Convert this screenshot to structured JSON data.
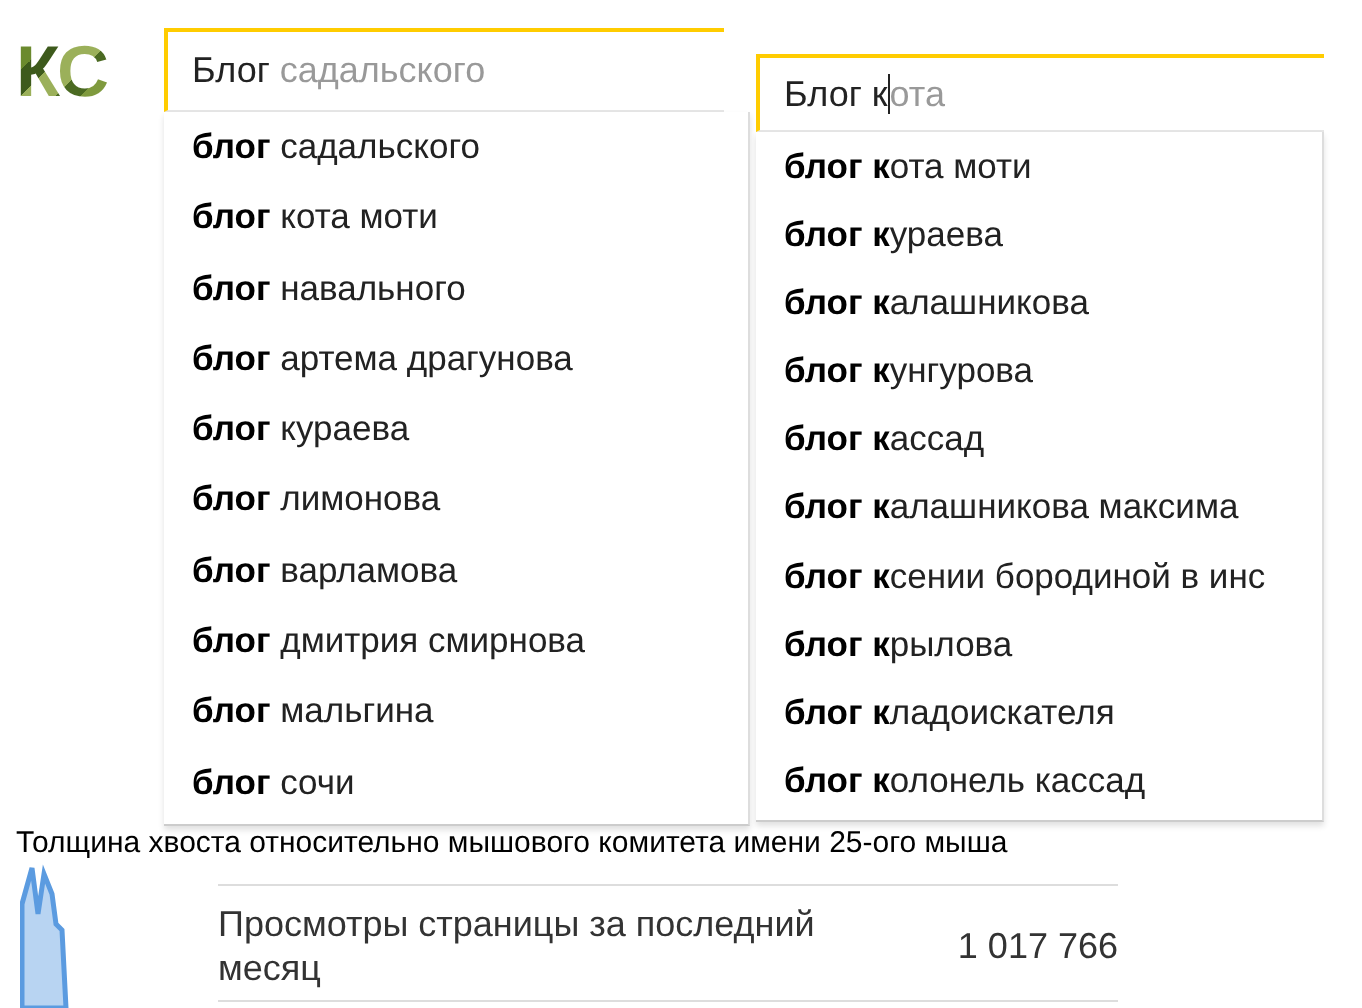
{
  "logo": {
    "text": "КС"
  },
  "searches": [
    {
      "query": "Блог ",
      "completion": "садальского",
      "cursor": false,
      "suggestions": [
        "**блог** садальского",
        "**блог** кота моти",
        "**блог** навального",
        "**блог** артема драгунова",
        "**блог** кураева",
        "**блог** лимонова",
        "**блог** варламова",
        "**блог** дмитрия смирнова",
        "**блог** мальгина",
        "**блог** сочи"
      ]
    },
    {
      "query": "Блог к",
      "completion": "ота",
      "cursor": true,
      "suggestions": [
        "**блог к**ота моти",
        "**блог к**ураева",
        "**блог к**алашникова",
        "**блог к**унгурова",
        "**блог к**ассад",
        "**блог к**алашникова максима",
        "**блог к**сении бородиной в инс",
        "**блог к**рылова",
        "**блог к**ладоискателя",
        "**блог к**олонель кассад"
      ]
    }
  ],
  "caption": "Толщина хвоста относительно мышового комитета имени 25-ого мыша",
  "stats": {
    "label": "Просмотры страницы за последний месяц",
    "value": "1 017 766"
  }
}
